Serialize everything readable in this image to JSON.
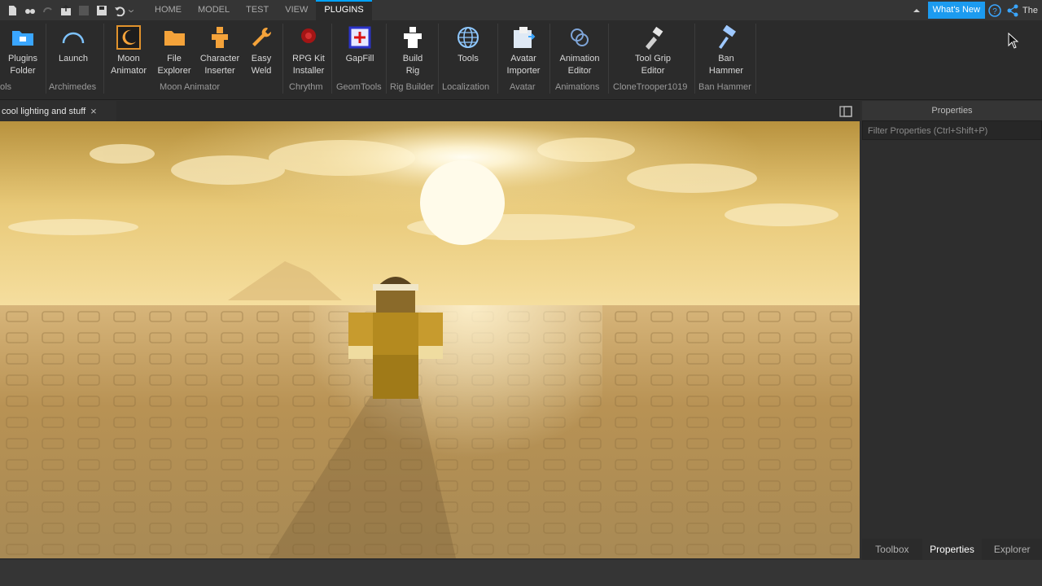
{
  "menubar": {
    "tabs": [
      {
        "label": "HOME",
        "active": false
      },
      {
        "label": "MODEL",
        "active": false
      },
      {
        "label": "TEST",
        "active": false
      },
      {
        "label": "VIEW",
        "active": false
      },
      {
        "label": "PLUGINS",
        "active": true
      }
    ],
    "whats_new": "What's New",
    "user": "The"
  },
  "ribbon": {
    "tools": [
      {
        "label": "Plugins\nFolder",
        "icon": "folder-plug-icon"
      },
      {
        "label": "Launch",
        "icon": "arc-icon"
      },
      {
        "label": "Moon\nAnimator",
        "icon": "moon-icon"
      },
      {
        "label": "File\nExplorer",
        "icon": "folder-icon"
      },
      {
        "label": "Character\nInserter",
        "icon": "character-icon"
      },
      {
        "label": "Easy\nWeld",
        "icon": "wrench-icon"
      },
      {
        "label": "RPG Kit\nInstaller",
        "icon": "rpg-icon"
      },
      {
        "label": "GapFill",
        "icon": "gapfill-icon"
      },
      {
        "label": "Build\nRig",
        "icon": "rig-icon"
      },
      {
        "label": "Tools",
        "icon": "globe-icon"
      },
      {
        "label": "Avatar\nImporter",
        "icon": "avatar-icon"
      },
      {
        "label": "Animation\nEditor",
        "icon": "animation-icon"
      },
      {
        "label": "Tool Grip\nEditor",
        "icon": "grip-icon"
      },
      {
        "label": "Ban\nHammer",
        "icon": "hammer-icon"
      }
    ],
    "groups": [
      "ols",
      "Archimedes",
      "Moon Animator",
      "Chrythm",
      "GeomTools",
      "Rig Builder",
      "Localization",
      "Avatar",
      "Animations",
      "CloneTrooper1019",
      "Ban Hammer"
    ]
  },
  "document": {
    "tab_label": "cool lighting and stuff",
    "close_glyph": "×"
  },
  "properties": {
    "title": "Properties",
    "filter_placeholder": "Filter Properties (Ctrl+Shift+P)",
    "bottom_tabs": [
      {
        "label": "Toolbox",
        "active": false
      },
      {
        "label": "Properties",
        "active": true
      },
      {
        "label": "Explorer",
        "active": false
      }
    ]
  },
  "colors": {
    "accent": "#00a2ff",
    "whats_new_bg": "#1c9bf0",
    "sky_top": "#c9a34c",
    "sun": "#fff7e0",
    "baseplate": "#b8965a"
  }
}
